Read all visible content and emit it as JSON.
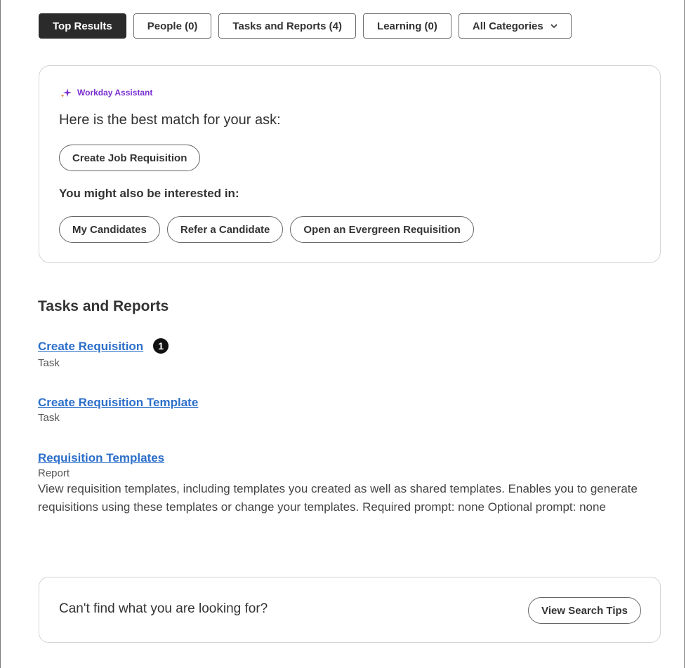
{
  "filters": {
    "top_results": "Top Results",
    "people": "People (0)",
    "tasks_reports": "Tasks and Reports (4)",
    "learning": "Learning (0)",
    "all_categories": "All Categories"
  },
  "assistant": {
    "label": "Workday Assistant",
    "prompt": "Here is the best match for your ask:",
    "best_match": "Create Job Requisition",
    "also_label": "You might also be interested in:",
    "suggestions": [
      "My Candidates",
      "Refer a Candidate",
      "Open an Evergreen Requisition"
    ],
    "accent_color": "#7b2fd0"
  },
  "tasks": {
    "title": "Tasks and Reports",
    "items": [
      {
        "name": "Create Requisition",
        "type": "Task",
        "marker": "1"
      },
      {
        "name": "Create Requisition Template",
        "type": "Task"
      },
      {
        "name": "Requisition Templates",
        "type": "Report",
        "description": "View requisition templates, including templates you created as well as shared templates. Enables you to generate requisitions using these templates or change your templates. Required prompt: none Optional prompt: none"
      }
    ]
  },
  "help": {
    "question": "Can't find what you are looking for?",
    "button": "View Search Tips"
  }
}
